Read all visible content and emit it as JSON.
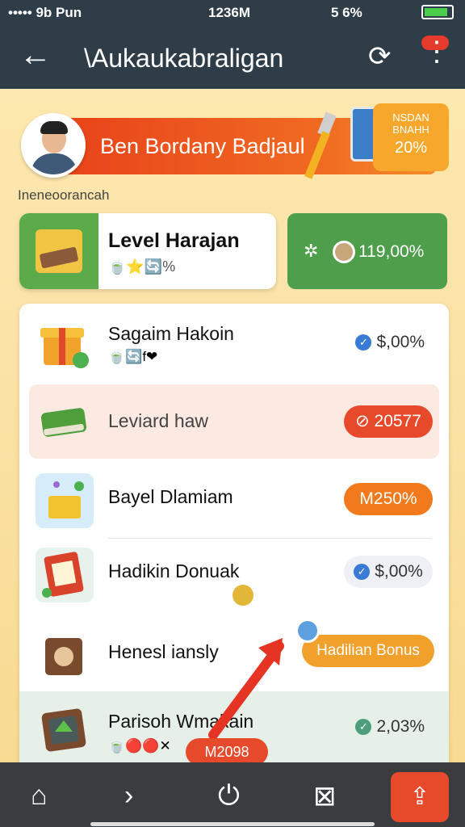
{
  "status_bar": {
    "signal": "••••• 9b Pun",
    "time": "1236M",
    "battery_text": "5 6%"
  },
  "app_bar": {
    "title": "\\Aukaukabraligan"
  },
  "banner": {
    "text": "Ben Bordany Badjaul",
    "badge_line1": "NSDAN",
    "badge_line2": "BNAHH",
    "badge_percent": "20%"
  },
  "subtitle": "Ineneoorancah",
  "level_card": {
    "title": "Level Harajan",
    "icons_text": "🍵⭐🔄%"
  },
  "coins_card": {
    "value": "119,00%"
  },
  "rows": [
    {
      "title": "Sagaim Hakoin",
      "sub": "🍵🔄f❤",
      "value": "$,00%"
    },
    {
      "title": "Leviard haw",
      "pill": "⊘ 20577"
    },
    {
      "title": "Bayel Dlamiam",
      "pill": "M250%"
    },
    {
      "title": "Hadikin Donuak",
      "value": "$,00%"
    },
    {
      "title": "Henesl iansly",
      "pill": "Hadilian Bonus"
    },
    {
      "title": "Parisoh Wmakain",
      "sub": "🍵🔴🔴✕",
      "value": "2,03%"
    }
  ],
  "floating_pill": "M2098",
  "colors": {
    "dark_bar": "#2e3d48",
    "accent_orange": "#f07a1c",
    "accent_red": "#e64a2b",
    "green": "#4f9e4c",
    "check_blue": "#3a7bd5"
  }
}
